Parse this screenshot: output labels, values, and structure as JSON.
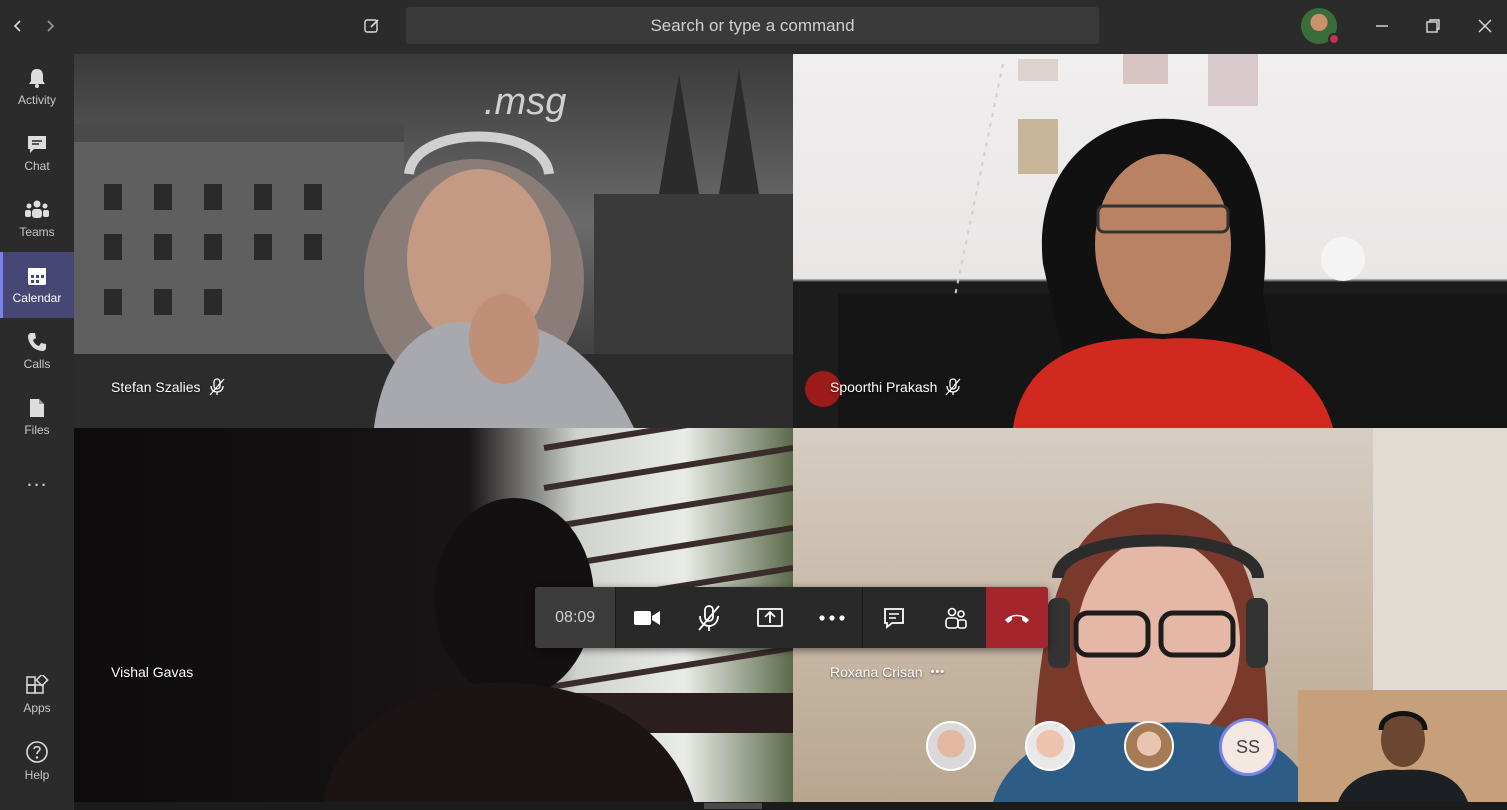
{
  "titlebar": {
    "search_placeholder": "Search or type a command"
  },
  "rail": {
    "items": [
      {
        "label": "Activity",
        "icon": "bell-icon"
      },
      {
        "label": "Chat",
        "icon": "chat-icon"
      },
      {
        "label": "Teams",
        "icon": "teams-icon"
      },
      {
        "label": "Calendar",
        "icon": "calendar-icon",
        "active": true
      },
      {
        "label": "Calls",
        "icon": "phone-icon"
      },
      {
        "label": "Files",
        "icon": "file-icon"
      }
    ],
    "more": "...",
    "bottom": [
      {
        "label": "Apps",
        "icon": "apps-icon"
      },
      {
        "label": "Help",
        "icon": "help-icon"
      }
    ]
  },
  "tiles": [
    {
      "name": "Stefan Szalies",
      "muted": true
    },
    {
      "name": "Spoorthi Prakash",
      "muted": true
    },
    {
      "name": "Vishal Gavas"
    },
    {
      "name": "Roxana Crisan",
      "more": "•••"
    }
  ],
  "call": {
    "timer": "08:09"
  },
  "participants_overflow": {
    "initials": "SS"
  },
  "colors": {
    "rail_active": "#464775",
    "accent": "#7b83eb",
    "hangup": "#a4262c"
  }
}
